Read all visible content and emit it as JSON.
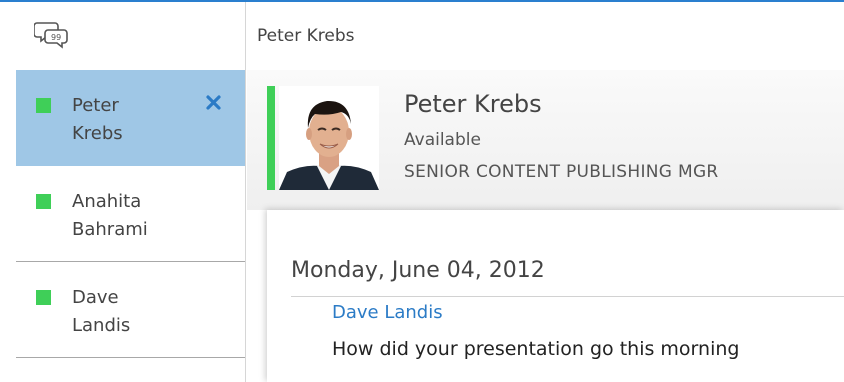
{
  "window": {
    "title": "Peter Krebs"
  },
  "sidebar": {
    "chat_icon": "chat-bubbles-icon",
    "conversations": [
      {
        "first": "Peter",
        "last": "Krebs",
        "presence": "available",
        "selected": true,
        "close_icon": "close-icon"
      },
      {
        "first": "Anahita",
        "last": "Bahrami",
        "presence": "available",
        "selected": false
      },
      {
        "first": "Dave",
        "last": "Landis",
        "presence": "available",
        "selected": false
      }
    ]
  },
  "contact": {
    "name": "Peter Krebs",
    "status": "Available",
    "job_title": "SENIOR CONTENT PUBLISHING MGR",
    "presence_color": "#3fcf58"
  },
  "conversation": {
    "date": "Monday, June 04, 2012",
    "sender": "Dave Landis",
    "message": "How did your presentation go this morning"
  },
  "colors": {
    "accent": "#2b7bc6",
    "selected_bg": "#9fc7e6",
    "presence_available": "#3fcf58"
  }
}
